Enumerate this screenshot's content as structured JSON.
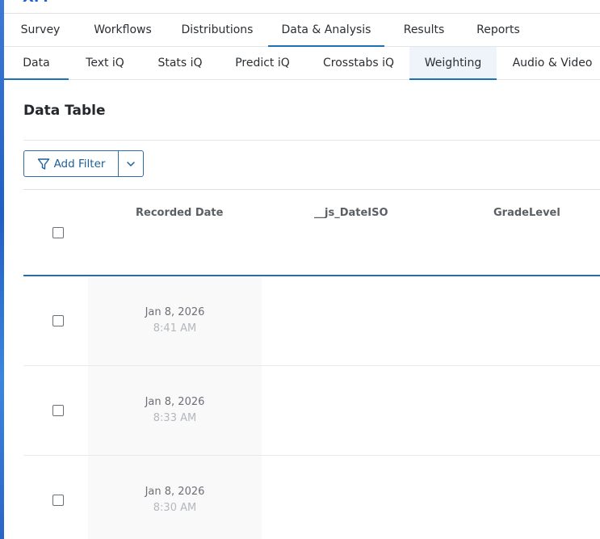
{
  "nav": {
    "main_tabs": [
      {
        "label": "Survey"
      },
      {
        "label": "Workflows"
      },
      {
        "label": "Distributions"
      },
      {
        "label": "Data & Analysis"
      },
      {
        "label": "Results"
      },
      {
        "label": "Reports"
      }
    ],
    "sub_tabs": [
      {
        "label": "Data"
      },
      {
        "label": "Text iQ"
      },
      {
        "label": "Stats iQ"
      },
      {
        "label": "Predict iQ"
      },
      {
        "label": "Crosstabs iQ"
      },
      {
        "label": "Weighting"
      },
      {
        "label": "Audio & Video"
      }
    ]
  },
  "page": {
    "title": "Data Table",
    "add_filter_label": "Add Filter"
  },
  "table": {
    "columns": [
      "Recorded Date",
      "__js_DateISO",
      "GradeLevel"
    ],
    "rows": [
      {
        "date": "Jan 8, 2026",
        "time": "8:41 AM"
      },
      {
        "date": "Jan 8, 2026",
        "time": "8:33 AM"
      },
      {
        "date": "Jan 8, 2026",
        "time": "8:30 AM"
      }
    ]
  },
  "colors": {
    "accent": "#1a73b8",
    "filter_text": "#1d5f99"
  }
}
